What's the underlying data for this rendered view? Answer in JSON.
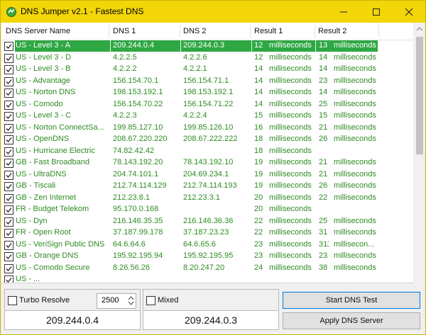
{
  "window": {
    "title": "DNS Jumper v2.1 - Fastest DNS"
  },
  "columns": {
    "name": "DNS Server Name",
    "dns1": "DNS 1",
    "dns2": "DNS 2",
    "result1": "Result 1",
    "result2": "Result 2"
  },
  "rows": [
    {
      "name": "US - Level 3 - A",
      "dns1": "209.244.0.4",
      "dns2": "209.244.0.3",
      "r1": "12",
      "r1u": "milliseconds",
      "r2": "13",
      "r2u": "milliseconds",
      "checked": true,
      "selected": true
    },
    {
      "name": "US - Level 3 - D",
      "dns1": "4.2.2.5",
      "dns2": "4.2.2.6",
      "r1": "12",
      "r1u": "milliseconds",
      "r2": "14",
      "r2u": "milliseconds",
      "checked": true
    },
    {
      "name": "US - Level 3 - B",
      "dns1": "4.2.2.2",
      "dns2": "4.2.2.1",
      "r1": "14",
      "r1u": "milliseconds",
      "r2": "14",
      "r2u": "milliseconds",
      "checked": true
    },
    {
      "name": "US - Advantage",
      "dns1": "156.154.70.1",
      "dns2": "156.154.71.1",
      "r1": "14",
      "r1u": "milliseconds",
      "r2": "23",
      "r2u": "milliseconds",
      "checked": true
    },
    {
      "name": "US - Norton DNS",
      "dns1": "198.153.192.1",
      "dns2": "198.153.192.1",
      "r1": "14",
      "r1u": "milliseconds",
      "r2": "14",
      "r2u": "milliseconds",
      "checked": true
    },
    {
      "name": "US - Comodo",
      "dns1": "156.154.70.22",
      "dns2": "156.154.71.22",
      "r1": "14",
      "r1u": "milliseconds",
      "r2": "25",
      "r2u": "milliseconds",
      "checked": true
    },
    {
      "name": "US - Level 3 - C",
      "dns1": "4.2.2.3",
      "dns2": "4.2.2.4",
      "r1": "15",
      "r1u": "milliseconds",
      "r2": "15",
      "r2u": "milliseconds",
      "checked": true
    },
    {
      "name": "US - Norton ConnectSa...",
      "dns1": "199.85.127.10",
      "dns2": "199.85.126.10",
      "r1": "16",
      "r1u": "milliseconds",
      "r2": "21",
      "r2u": "milliseconds",
      "checked": true
    },
    {
      "name": "US - OpenDNS",
      "dns1": "208.67.220.220",
      "dns2": "208.67.222.222",
      "r1": "18",
      "r1u": "milliseconds",
      "r2": "26",
      "r2u": "milliseconds",
      "checked": true
    },
    {
      "name": "US - Hurricane Electric",
      "dns1": "74.82.42.42",
      "dns2": "",
      "r1": "18",
      "r1u": "milliseconds",
      "r2": "",
      "r2u": "",
      "checked": true
    },
    {
      "name": "GB - Fast Broadband",
      "dns1": "78.143.192.20",
      "dns2": "78.143.192.10",
      "r1": "19",
      "r1u": "milliseconds",
      "r2": "21",
      "r2u": "milliseconds",
      "checked": true
    },
    {
      "name": "US - UltraDNS",
      "dns1": "204.74.101.1",
      "dns2": "204.69.234.1",
      "r1": "19",
      "r1u": "milliseconds",
      "r2": "21",
      "r2u": "milliseconds",
      "checked": true
    },
    {
      "name": "GB - Tiscali",
      "dns1": "212.74.114.129",
      "dns2": "212.74.114.193",
      "r1": "19",
      "r1u": "milliseconds",
      "r2": "26",
      "r2u": "milliseconds",
      "checked": true
    },
    {
      "name": "GB - Zen Internet",
      "dns1": "212.23.8.1",
      "dns2": "212.23.3.1",
      "r1": "20",
      "r1u": "milliseconds",
      "r2": "22",
      "r2u": "milliseconds",
      "checked": true
    },
    {
      "name": "FR - Budget Telekom",
      "dns1": "95.170.0.168",
      "dns2": "",
      "r1": "20",
      "r1u": "milliseconds",
      "r2": "",
      "r2u": "",
      "checked": true
    },
    {
      "name": "US - Dyn",
      "dns1": "216.146.35.35",
      "dns2": "216.146.36.36",
      "r1": "22",
      "r1u": "milliseconds",
      "r2": "25",
      "r2u": "milliseconds",
      "checked": true
    },
    {
      "name": "FR - Open Root",
      "dns1": "37.187.99.178",
      "dns2": "37.187.23.23",
      "r1": "22",
      "r1u": "milliseconds",
      "r2": "31",
      "r2u": "milliseconds",
      "checked": true
    },
    {
      "name": "US - VeriSign Public DNS",
      "dns1": "64.6.64.6",
      "dns2": "64.6.65.6",
      "r1": "23",
      "r1u": "milliseconds",
      "r2": "311",
      "r2u": "millisecon...",
      "checked": true
    },
    {
      "name": "GB - Orange DNS",
      "dns1": "195.92.195.94",
      "dns2": "195.92.195.95",
      "r1": "23",
      "r1u": "milliseconds",
      "r2": "23",
      "r2u": "milliseconds",
      "checked": true
    },
    {
      "name": "US - Comodo Secure",
      "dns1": "8.26.56.26",
      "dns2": "8.20.247.20",
      "r1": "24",
      "r1u": "milliseconds",
      "r2": "38",
      "r2u": "milliseconds",
      "checked": true
    },
    {
      "name": "US - ...",
      "dns1": "",
      "dns2": "",
      "r1": "",
      "r1u": "",
      "r2": "",
      "r2u": "",
      "checked": true
    }
  ],
  "controls": {
    "turbo_label": "Turbo Resolve",
    "turbo_value": "2500",
    "mixed_label": "Mixed",
    "dns1_display": "209.244.0.4",
    "dns2_display": "209.244.0.3",
    "start_button": "Start DNS Test",
    "apply_button": "Apply DNS Server"
  },
  "colors": {
    "titlebar": "#f2d60a",
    "selected_row": "#2ea843",
    "row_text": "#2e8b22"
  }
}
